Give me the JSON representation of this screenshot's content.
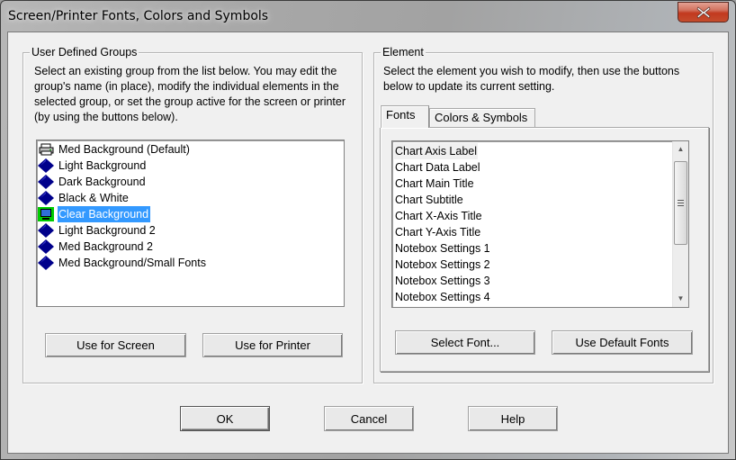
{
  "window": {
    "title": "Screen/Printer Fonts, Colors and Symbols",
    "close_icon": "close-icon"
  },
  "groups": {
    "legend": "User Defined Groups",
    "description": "Select an existing group from the list below.  You may edit the group's name (in place), modify the individual elements in the selected group, or set the group active for the screen or printer (by using the buttons below).",
    "items": [
      {
        "label": "Med Background (Default)",
        "icon": "printer-icon",
        "selected": false
      },
      {
        "label": "Light Background",
        "icon": "diamond-icon",
        "selected": false
      },
      {
        "label": "Dark Background",
        "icon": "diamond-icon",
        "selected": false
      },
      {
        "label": "Black & White",
        "icon": "diamond-icon",
        "selected": false
      },
      {
        "label": "Clear Background",
        "icon": "monitor-icon",
        "selected": true
      },
      {
        "label": "Light Background 2",
        "icon": "diamond-icon",
        "selected": false
      },
      {
        "label": "Med Background 2",
        "icon": "diamond-icon",
        "selected": false
      },
      {
        "label": "Med Background/Small Fonts",
        "icon": "diamond-icon",
        "selected": false
      }
    ],
    "use_for_screen_label": "Use for Screen",
    "use_for_printer_label": "Use for Printer"
  },
  "element": {
    "legend": "Element",
    "description": "Select the element you wish to modify, then use the buttons below to update its current setting.",
    "tabs": [
      {
        "label": "Fonts",
        "active": true
      },
      {
        "label": "Colors & Symbols",
        "active": false
      }
    ],
    "items": [
      "Chart Axis Label",
      "Chart Data Label",
      "Chart Main Title",
      "Chart Subtitle",
      "Chart X-Axis Title",
      "Chart Y-Axis Title",
      "Notebox Settings 1",
      "Notebox Settings 2",
      "Notebox Settings 3",
      "Notebox Settings 4"
    ],
    "focused_item": "Chart Axis Label",
    "select_font_label": "Select Font...",
    "use_default_fonts_label": "Use Default Fonts"
  },
  "footer": {
    "ok_label": "OK",
    "cancel_label": "Cancel",
    "help_label": "Help"
  },
  "colors": {
    "selection": "#3399ff",
    "diamond": "#00008b",
    "monitor_bg": "#00cc00",
    "close_button": "#c2391f"
  }
}
